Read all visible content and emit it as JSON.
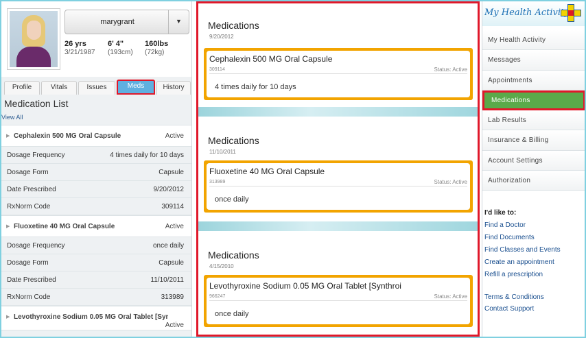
{
  "profile": {
    "username": "marygrant",
    "age": "26 yrs",
    "dob": "3/21/1987",
    "height": "6' 4\"",
    "height_cm": "(193cm)",
    "weight": "160lbs",
    "weight_kg": "(72kg)"
  },
  "tabs": [
    "Profile",
    "Vitals",
    "Issues",
    "Meds",
    "History"
  ],
  "active_tab": "Meds",
  "list_title": "Medication List",
  "view_all": "View All",
  "med_list": [
    {
      "name": "Cephalexin 500 MG Oral Capsule",
      "status": "Active",
      "fields": [
        {
          "k": "Dosage Frequency",
          "v": "4 times daily for 10 days"
        },
        {
          "k": "Dosage Form",
          "v": "Capsule"
        },
        {
          "k": "Date Prescribed",
          "v": "9/20/2012"
        },
        {
          "k": "RxNorm Code",
          "v": "309114"
        }
      ]
    },
    {
      "name": "Fluoxetine 40 MG Oral Capsule",
      "status": "Active",
      "fields": [
        {
          "k": "Dosage Frequency",
          "v": "once daily"
        },
        {
          "k": "Dosage Form",
          "v": "Capsule"
        },
        {
          "k": "Date Prescribed",
          "v": "11/10/2011"
        },
        {
          "k": "RxNorm Code",
          "v": "313989"
        }
      ]
    },
    {
      "name": "Levothyroxine Sodium 0.05 MG Oral Tablet [Synthroi",
      "status": "Active",
      "fields": []
    }
  ],
  "detail_cards": [
    {
      "heading": "Medications",
      "date": "9/20/2012",
      "name": "Cephalexin 500 MG Oral Capsule",
      "code": "309114",
      "status": "Status: Active",
      "frequency": "4 times daily for 10 days"
    },
    {
      "heading": "Medications",
      "date": "11/10/2011",
      "name": "Fluoxetine 40 MG Oral Capsule",
      "code": "313989",
      "status": "Status: Active",
      "frequency": "once daily"
    },
    {
      "heading": "Medications",
      "date": "4/15/2010",
      "name": "Levothyroxine Sodium 0.05 MG Oral Tablet [Synthroi",
      "code": "966247",
      "status": "Status: Active",
      "frequency": "once daily"
    }
  ],
  "logo_text": "My Health Activity",
  "nav": [
    "My Health Activity",
    "Messages",
    "Appointments",
    "Medications",
    "Lab Results",
    "Insurance & Billing",
    "Account Settings",
    "Authorization"
  ],
  "active_nav": "Medications",
  "like_heading": "I'd like to:",
  "links": [
    "Find a Doctor",
    "Find Documents",
    "Find Classes and Events",
    "Create an appointment",
    "Refill a prescription"
  ],
  "footer_links": [
    "Terms & Conditions",
    "Contact Support"
  ],
  "colors": {
    "highlight": "#e0182a",
    "accent_orange": "#f2a400",
    "nav_active": "#5aaa4a",
    "tab_active": "#5fb0e0"
  }
}
